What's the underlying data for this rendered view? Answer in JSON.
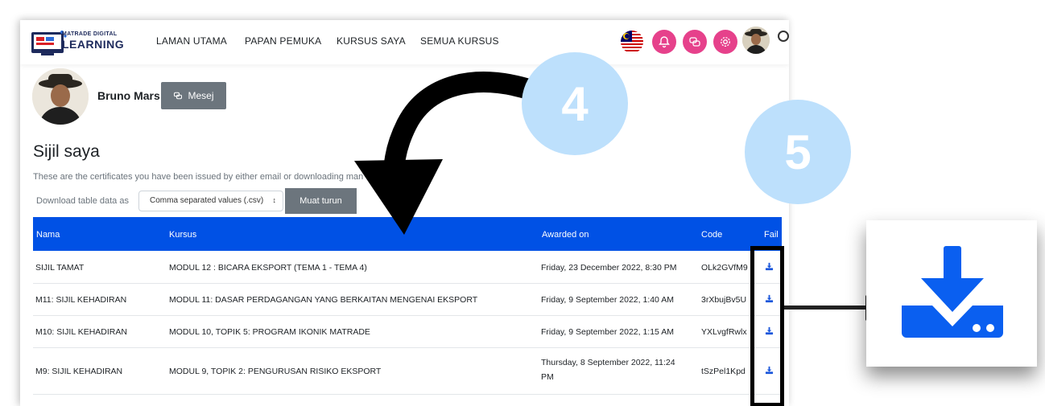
{
  "nav": {
    "logo_small": "MATRADE DIGITAL",
    "logo_big": "LEARNING",
    "items": [
      "LAMAN UTAMA",
      "PAPAN PEMUKA",
      "KURSUS SAYA",
      "SEMUA KURSUS"
    ]
  },
  "profile": {
    "name": "Bruno Mars",
    "message_button": "Mesej"
  },
  "page": {
    "title": "Sijil saya",
    "description": "These are the certificates you have been issued by either email or downloading man",
    "download_label": "Download table data as",
    "download_format": "Comma separated values (.csv)",
    "download_button": "Muat turun"
  },
  "table": {
    "headers": [
      "Nama",
      "Kursus",
      "Awarded on",
      "Code",
      "Fail"
    ],
    "rows": [
      {
        "nama": "SIJIL TAMAT",
        "kursus": "MODUL 12 : BICARA EKSPORT (TEMA 1 - TEMA 4)",
        "awarded": "Friday, 23 December 2022, 8:30 PM",
        "code": "OLk2GVfM9"
      },
      {
        "nama": "M11: SIJIL KEHADIRAN",
        "kursus": "MODUL 11: DASAR PERDAGANGAN YANG BERKAITAN MENGENAI EKSPORT",
        "awarded": "Friday, 9 September 2022, 1:40 AM",
        "code": "3rXbujBv5U"
      },
      {
        "nama": "M10: SIJIL KEHADIRAN",
        "kursus": "MODUL 10, TOPIK 5: PROGRAM IKONIK MATRADE",
        "awarded": "Friday, 9 September 2022, 1:15 AM",
        "code": "YXLvgfRwlx"
      },
      {
        "nama": "M9: SIJIL KEHADIRAN",
        "kursus": "MODUL 9, TOPIK 2: PENGURUSAN RISIKO EKSPORT",
        "awarded_line1": "Thursday, 8 September 2022, 11:24",
        "awarded_line2": "PM",
        "code": "tSzPel1Kpd"
      }
    ]
  },
  "annotations": {
    "step_a": "4",
    "step_b": "5"
  },
  "colors": {
    "header_blue": "#0051e5",
    "icon_blue": "#1a56db",
    "callout_blue": "#bde0fc",
    "nav_pink": "#e6418b",
    "button_grey": "#6c757d"
  },
  "icons": [
    "language-flag-icon",
    "notification-bell-icon",
    "messages-icon",
    "settings-icon",
    "search-icon",
    "download-icon",
    "curved-arrow-icon"
  ]
}
